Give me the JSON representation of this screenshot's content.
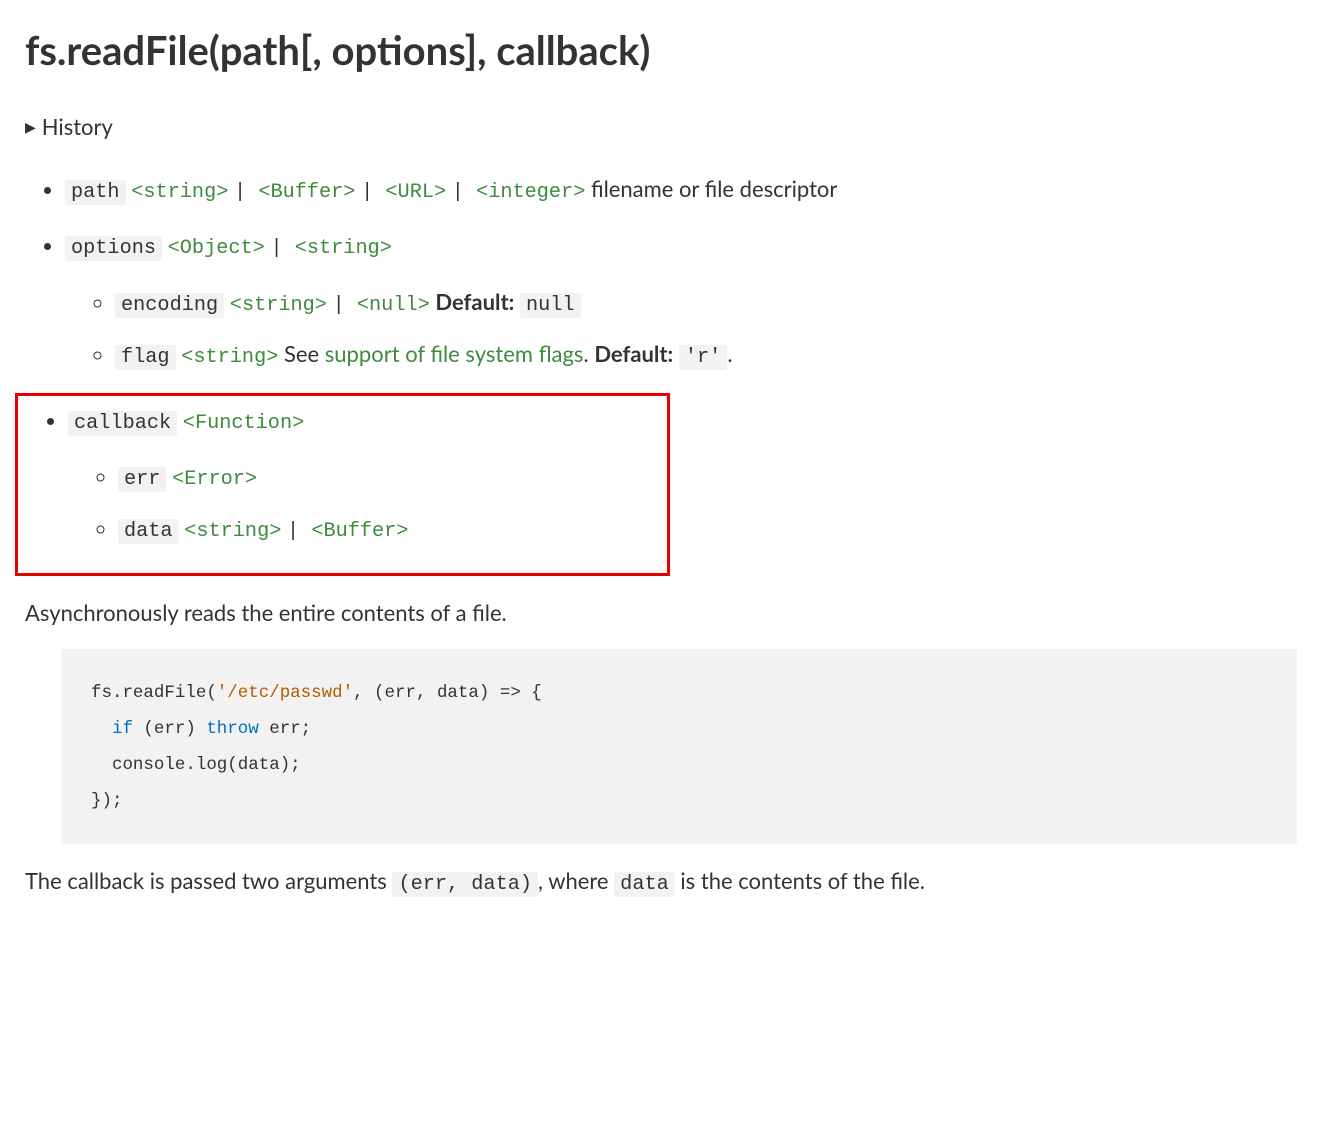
{
  "heading": "fs.readFile(path[, options], callback)",
  "history_label": "History",
  "params": {
    "path": {
      "name": "path",
      "types": [
        "<string>",
        "<Buffer>",
        "<URL>",
        "<integer>"
      ],
      "desc": "filename or file descriptor"
    },
    "options": {
      "name": "options",
      "types": [
        "<Object>",
        "<string>"
      ],
      "sub": {
        "encoding": {
          "name": "encoding",
          "types": [
            "<string>",
            "<null>"
          ],
          "default_label": "Default:",
          "default_val": "null"
        },
        "flag": {
          "name": "flag",
          "types": [
            "<string>"
          ],
          "see_text": "See",
          "see_link": "support of file system flags",
          "period": ".",
          "default_label": "Default:",
          "default_val": "'r'"
        }
      }
    },
    "callback": {
      "name": "callback",
      "types": [
        "<Function>"
      ],
      "sub": {
        "err": {
          "name": "err",
          "types": [
            "<Error>"
          ]
        },
        "data": {
          "name": "data",
          "types": [
            "<string>",
            "<Buffer>"
          ]
        }
      }
    }
  },
  "desc1": "Asynchronously reads the entire contents of a file.",
  "code": {
    "line1_a": "fs.readFile(",
    "line1_str": "'/etc/passwd'",
    "line1_b": ", (err, data) => {",
    "line2_a": "  ",
    "line2_kw1": "if",
    "line2_b": " (err) ",
    "line2_kw2": "throw",
    "line2_c": " err;",
    "line3": "  console.log(data);",
    "line4": "});"
  },
  "desc2_a": "The callback is passed two arguments ",
  "desc2_code1": "(err, data)",
  "desc2_b": ", where ",
  "desc2_code2": "data",
  "desc2_c": " is the contents of the file."
}
